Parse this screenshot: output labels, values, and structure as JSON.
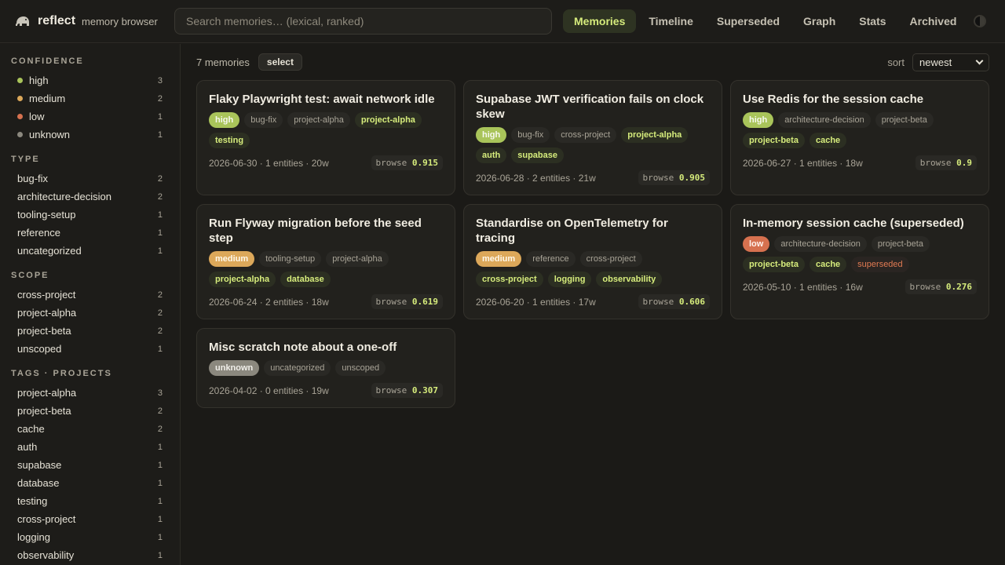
{
  "app": {
    "name": "reflect",
    "subtitle": "memory browser",
    "icon": "elephant-icon"
  },
  "search": {
    "placeholder": "Search memories… (lexical, ranked)"
  },
  "nav": {
    "tabs": [
      {
        "label": "Memories",
        "active": true
      },
      {
        "label": "Timeline"
      },
      {
        "label": "Superseded"
      },
      {
        "label": "Graph"
      },
      {
        "label": "Stats"
      },
      {
        "label": "Archived"
      }
    ],
    "theme_icon": "contrast-icon"
  },
  "sidebar": {
    "confidence": {
      "heading": "CONFIDENCE",
      "items": [
        {
          "label": "high",
          "count": "3",
          "color": "#a9c45a"
        },
        {
          "label": "medium",
          "count": "2",
          "color": "#dca85a"
        },
        {
          "label": "low",
          "count": "1",
          "color": "#d6714f"
        },
        {
          "label": "unknown",
          "count": "1",
          "color": "#8b887e"
        }
      ]
    },
    "type": {
      "heading": "TYPE",
      "items": [
        {
          "label": "bug-fix",
          "count": "2"
        },
        {
          "label": "architecture-decision",
          "count": "2"
        },
        {
          "label": "tooling-setup",
          "count": "1"
        },
        {
          "label": "reference",
          "count": "1"
        },
        {
          "label": "uncategorized",
          "count": "1"
        }
      ]
    },
    "scope": {
      "heading": "SCOPE",
      "items": [
        {
          "label": "cross-project",
          "count": "2"
        },
        {
          "label": "project-alpha",
          "count": "2"
        },
        {
          "label": "project-beta",
          "count": "2"
        },
        {
          "label": "unscoped",
          "count": "1"
        }
      ]
    },
    "tags": {
      "heading": "TAGS · PROJECTS",
      "items": [
        {
          "label": "project-alpha",
          "count": "3"
        },
        {
          "label": "project-beta",
          "count": "2"
        },
        {
          "label": "cache",
          "count": "2"
        },
        {
          "label": "auth",
          "count": "1"
        },
        {
          "label": "supabase",
          "count": "1"
        },
        {
          "label": "database",
          "count": "1"
        },
        {
          "label": "testing",
          "count": "1"
        },
        {
          "label": "cross-project",
          "count": "1"
        },
        {
          "label": "logging",
          "count": "1"
        },
        {
          "label": "observability",
          "count": "1"
        }
      ]
    }
  },
  "toolbar": {
    "count": "7 memories",
    "select_label": "select",
    "sort_label": "sort",
    "sort_value": "newest"
  },
  "cards": [
    {
      "title": "Flaky Playwright test: await network idle",
      "tags": [
        {
          "t": "high",
          "k": "conf-high"
        },
        {
          "t": "bug-fix",
          "k": "plain"
        },
        {
          "t": "project-alpha",
          "k": "plain"
        },
        {
          "t": "project-alpha",
          "k": "accent"
        },
        {
          "t": "testing",
          "k": "accent"
        }
      ],
      "meta": "2026-06-30 · 1 entities · 20w",
      "score_label": "browse",
      "score": "0.915"
    },
    {
      "title": "Supabase JWT verification fails on clock skew",
      "tags": [
        {
          "t": "high",
          "k": "conf-high"
        },
        {
          "t": "bug-fix",
          "k": "plain"
        },
        {
          "t": "cross-project",
          "k": "plain"
        },
        {
          "t": "project-alpha",
          "k": "accent"
        },
        {
          "t": "auth",
          "k": "accent"
        },
        {
          "t": "supabase",
          "k": "accent"
        }
      ],
      "meta": "2026-06-28 · 2 entities · 21w",
      "score_label": "browse",
      "score": "0.905"
    },
    {
      "title": "Use Redis for the session cache",
      "tags": [
        {
          "t": "high",
          "k": "conf-high"
        },
        {
          "t": "architecture-decision",
          "k": "plain"
        },
        {
          "t": "project-beta",
          "k": "plain"
        },
        {
          "t": "project-beta",
          "k": "accent"
        },
        {
          "t": "cache",
          "k": "accent"
        }
      ],
      "meta": "2026-06-27 · 1 entities · 18w",
      "score_label": "browse",
      "score": "0.9"
    },
    {
      "title": "Run Flyway migration before the seed step",
      "tags": [
        {
          "t": "medium",
          "k": "conf-medium"
        },
        {
          "t": "tooling-setup",
          "k": "plain"
        },
        {
          "t": "project-alpha",
          "k": "plain"
        },
        {
          "t": "project-alpha",
          "k": "accent"
        },
        {
          "t": "database",
          "k": "accent"
        }
      ],
      "meta": "2026-06-24 · 2 entities · 18w",
      "score_label": "browse",
      "score": "0.619"
    },
    {
      "title": "Standardise on OpenTelemetry for tracing",
      "tags": [
        {
          "t": "medium",
          "k": "conf-medium"
        },
        {
          "t": "reference",
          "k": "plain"
        },
        {
          "t": "cross-project",
          "k": "plain"
        },
        {
          "t": "cross-project",
          "k": "accent"
        },
        {
          "t": "logging",
          "k": "accent"
        },
        {
          "t": "observability",
          "k": "accent"
        }
      ],
      "meta": "2026-06-20 · 1 entities · 17w",
      "score_label": "browse",
      "score": "0.606"
    },
    {
      "title": "In-memory session cache (superseded)",
      "tags": [
        {
          "t": "low",
          "k": "conf-low"
        },
        {
          "t": "architecture-decision",
          "k": "plain"
        },
        {
          "t": "project-beta",
          "k": "plain"
        },
        {
          "t": "project-beta",
          "k": "accent"
        },
        {
          "t": "cache",
          "k": "accent"
        },
        {
          "t": "superseded",
          "k": "superseded"
        }
      ],
      "meta": "2026-05-10 · 1 entities · 16w",
      "score_label": "browse",
      "score": "0.276"
    },
    {
      "title": "Misc scratch note about a one-off",
      "tags": [
        {
          "t": "unknown",
          "k": "conf-unknown"
        },
        {
          "t": "uncategorized",
          "k": "plain"
        },
        {
          "t": "unscoped",
          "k": "plain"
        }
      ],
      "meta": "2026-04-02 · 0 entities · 19w",
      "score_label": "browse",
      "score": "0.307"
    }
  ]
}
